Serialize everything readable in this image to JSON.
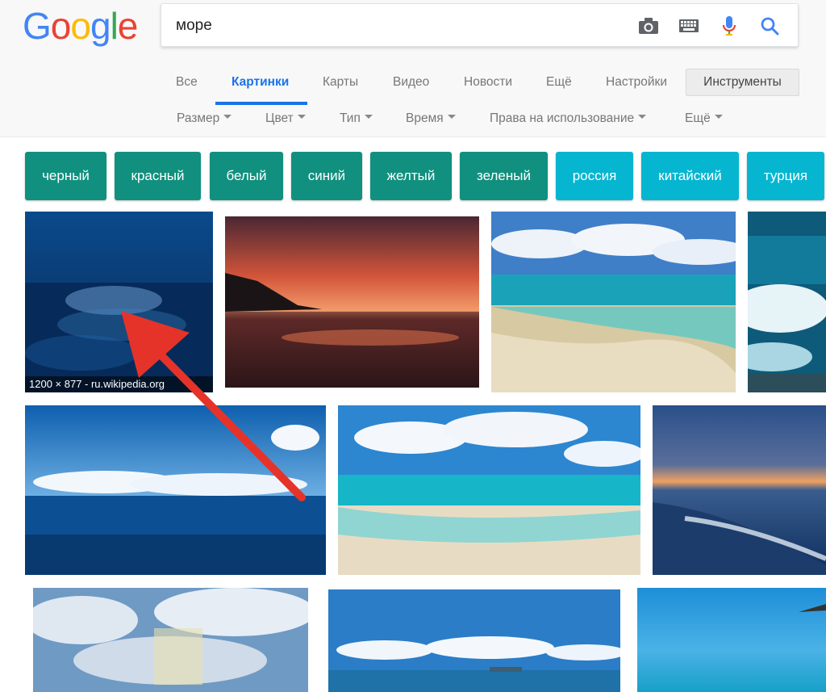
{
  "logo": {
    "letters": [
      "G",
      "o",
      "o",
      "g",
      "l",
      "e"
    ]
  },
  "search": {
    "query": "море"
  },
  "icons": {
    "camera": "camera-icon",
    "keyboard": "keyboard-icon",
    "mic": "microphone-icon",
    "search": "search-icon"
  },
  "tabs": [
    {
      "label": "Все"
    },
    {
      "label": "Картинки"
    },
    {
      "label": "Карты"
    },
    {
      "label": "Видео"
    },
    {
      "label": "Новости"
    },
    {
      "label": "Ещё"
    },
    {
      "label": "Настройки"
    }
  ],
  "tools": {
    "label": "Инструменты"
  },
  "filters": [
    {
      "label": "Размер"
    },
    {
      "label": "Цвет"
    },
    {
      "label": "Тип"
    },
    {
      "label": "Время"
    },
    {
      "label": "Права на использование"
    },
    {
      "label": "Ещё"
    }
  ],
  "chips": [
    {
      "label": "черный"
    },
    {
      "label": "красный"
    },
    {
      "label": "белый"
    },
    {
      "label": "синий"
    },
    {
      "label": "желтый"
    },
    {
      "label": "зеленый"
    },
    {
      "label": "россия"
    },
    {
      "label": "китайский"
    },
    {
      "label": "турция"
    }
  ],
  "image_meta": {
    "caption": "1200 × 877 - ru.wikipedia.org"
  },
  "colors": {
    "accent_blue": "#1a73e8",
    "chip_teal": "#11907f",
    "chip_cyan": "#06b6d1",
    "annotation_arrow": "#e5332a"
  }
}
